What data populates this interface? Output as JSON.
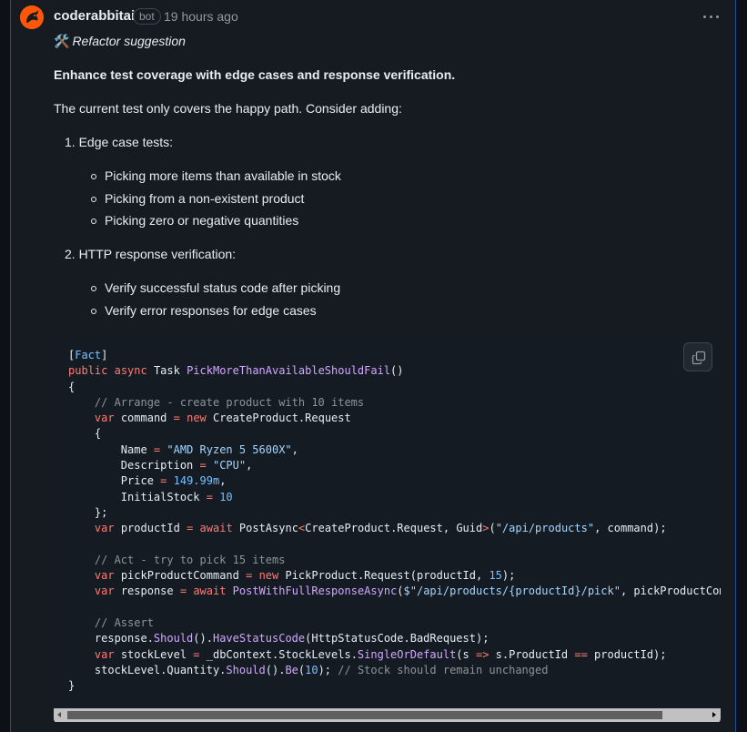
{
  "comment": {
    "author": "coderabbitai",
    "badge": "bot",
    "timestamp": "19 hours ago",
    "suggestion_label": "Refactor suggestion",
    "heading": "Enhance test coverage with edge cases and response verification.",
    "intro": "The current test only covers the happy path. Consider adding:",
    "list": [
      {
        "label": "1. Edge case tests:",
        "items": [
          "Picking more items than available in stock",
          "Picking from a non-existent product",
          "Picking zero or negative quantities"
        ]
      },
      {
        "label": "2. HTTP response verification:",
        "items": [
          "Verify successful status code after picking",
          "Verify error responses for edge cases"
        ]
      }
    ]
  },
  "code": {
    "language": "csharp",
    "lines": [
      "[Fact]",
      "public async Task PickMoreThanAvailableShouldFail()",
      "{",
      "    // Arrange - create product with 10 items",
      "    var command = new CreateProduct.Request",
      "    {",
      "        Name = \"AMD Ryzen 5 5600X\",",
      "        Description = \"CPU\",",
      "        Price = 149.99m,",
      "        InitialStock = 10",
      "    };",
      "    var productId = await PostAsync<CreateProduct.Request, Guid>(\"/api/products\", command);",
      "",
      "    // Act - try to pick 15 items",
      "    var pickProductCommand = new PickProduct.Request(productId, 15);",
      "    var response = await PostWithFullResponseAsync($\"/api/products/{productId}/pick\", pickProductComm",
      "",
      "    // Assert",
      "    response.Should().HaveStatusCode(HttpStatusCode.BadRequest);",
      "    var stockLevel = _dbContext.StockLevels.SingleOrDefault(s => s.ProductId == productId);",
      "    stockLevel.Quantity.Should().Be(10); // Stock should remain unchanged",
      "}"
    ]
  },
  "colors": {
    "background": "#0d1117",
    "card": "#161b22",
    "code_bg": "#151b23",
    "accent": "#2f81f7",
    "avatar": "#ff570a"
  },
  "icons": [
    "avatar-rabbit-icon",
    "hammer-wrench-icon",
    "kebab-menu-icon",
    "copy-icon",
    "scroll-left-icon",
    "scroll-right-icon"
  ]
}
